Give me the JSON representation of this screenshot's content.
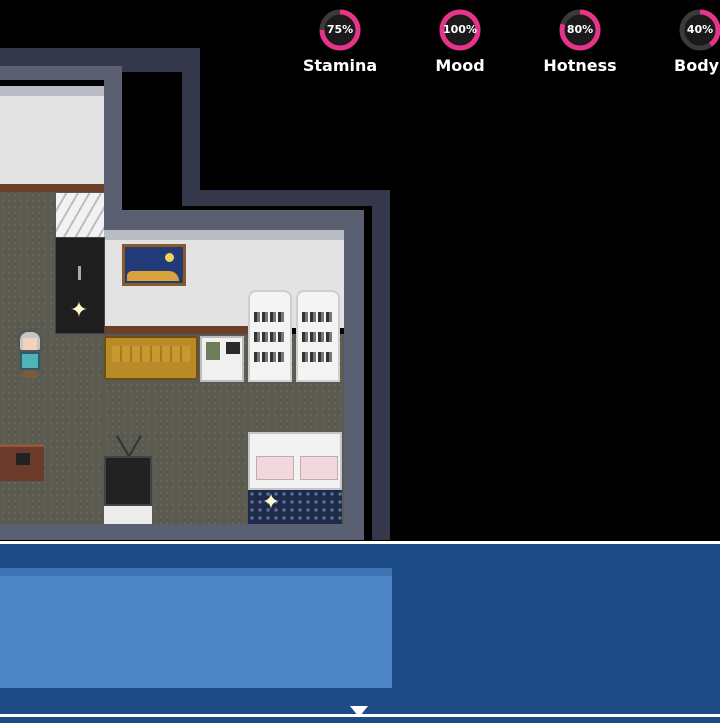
{
  "hud": {
    "stats": [
      {
        "label": "Stamina",
        "percent_text": "75%",
        "value": 0.75
      },
      {
        "label": "Mood",
        "percent_text": "100%",
        "value": 1.0
      },
      {
        "label": "Hotness",
        "percent_text": "80%",
        "value": 0.8
      },
      {
        "label": "Body",
        "percent_text": "40%",
        "value": 0.4
      }
    ],
    "ring_color": "#e8338a",
    "ring_track_color": "#3a3a3a"
  },
  "message_window": {
    "text": "",
    "continue_icon": "triangle-down-icon",
    "frame_color": "#1d4b86",
    "panel_color": "#4f86c6"
  }
}
